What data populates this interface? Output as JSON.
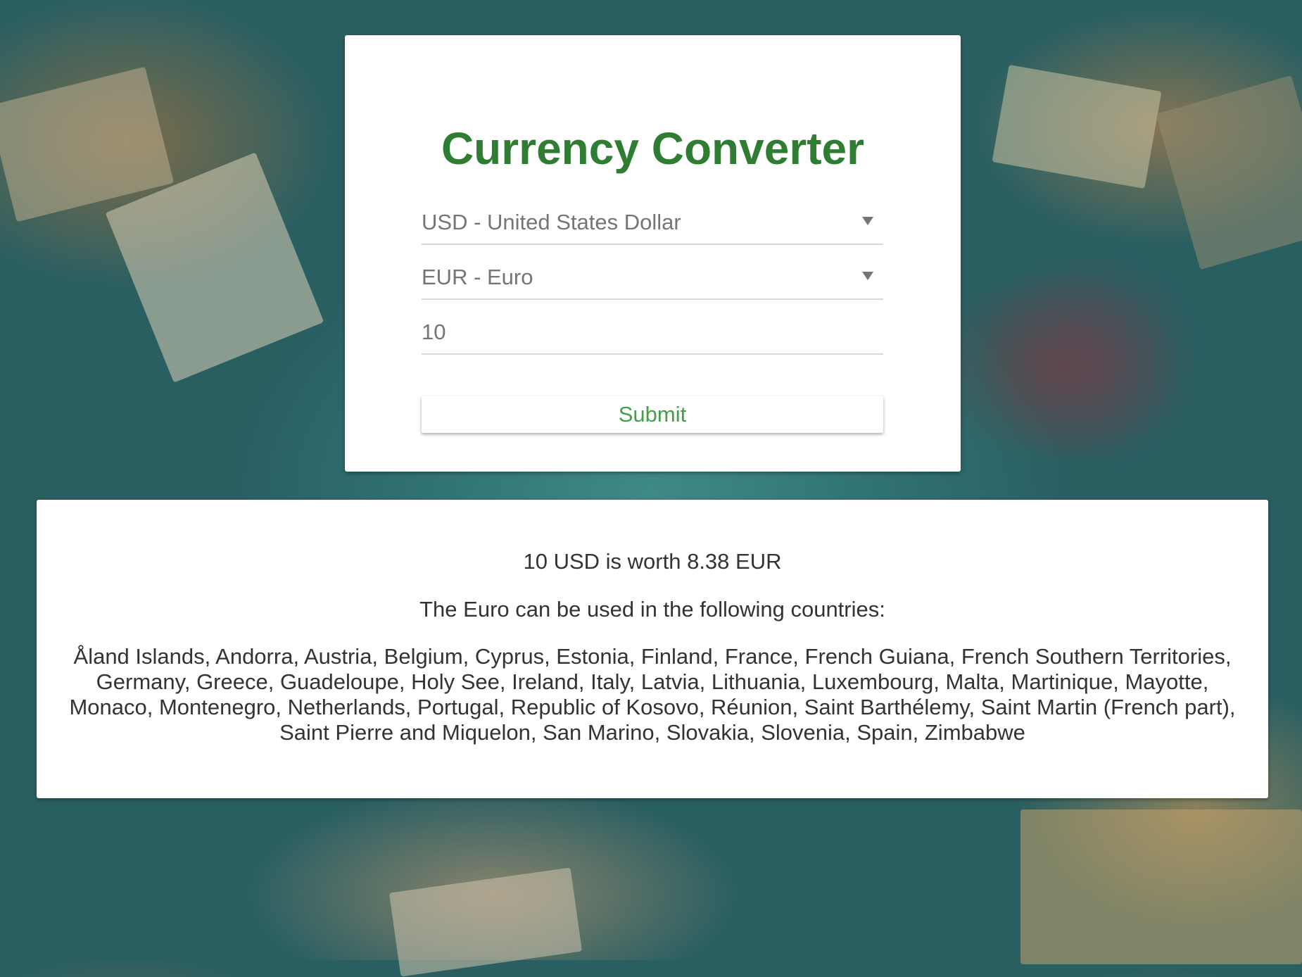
{
  "converter": {
    "title": "Currency Converter",
    "from_currency": "USD - United States Dollar",
    "to_currency": "EUR - Euro",
    "amount": "10",
    "submit_label": "Submit"
  },
  "result": {
    "conversion_text": "10 USD is worth 8.38 EUR",
    "countries_intro": "The Euro can be used in the following countries:",
    "countries_list": "Åland Islands, Andorra, Austria, Belgium, Cyprus, Estonia, Finland, France, French Guiana, French Southern Territories, Germany, Greece, Guadeloupe, Holy See, Ireland, Italy, Latvia, Lithuania, Luxembourg, Malta, Martinique, Mayotte, Monaco, Montenegro, Netherlands, Portugal, Republic of Kosovo, Réunion, Saint Barthélemy, Saint Martin (French part), Saint Pierre and Miquelon, San Marino, Slovakia, Slovenia, Spain, Zimbabwe"
  },
  "colors": {
    "accent_green": "#2e7d32",
    "button_text_green": "#43a047",
    "card_background": "#ffffff",
    "text_color": "#333333"
  },
  "icons": {
    "dropdown": "chevron-down-icon"
  }
}
